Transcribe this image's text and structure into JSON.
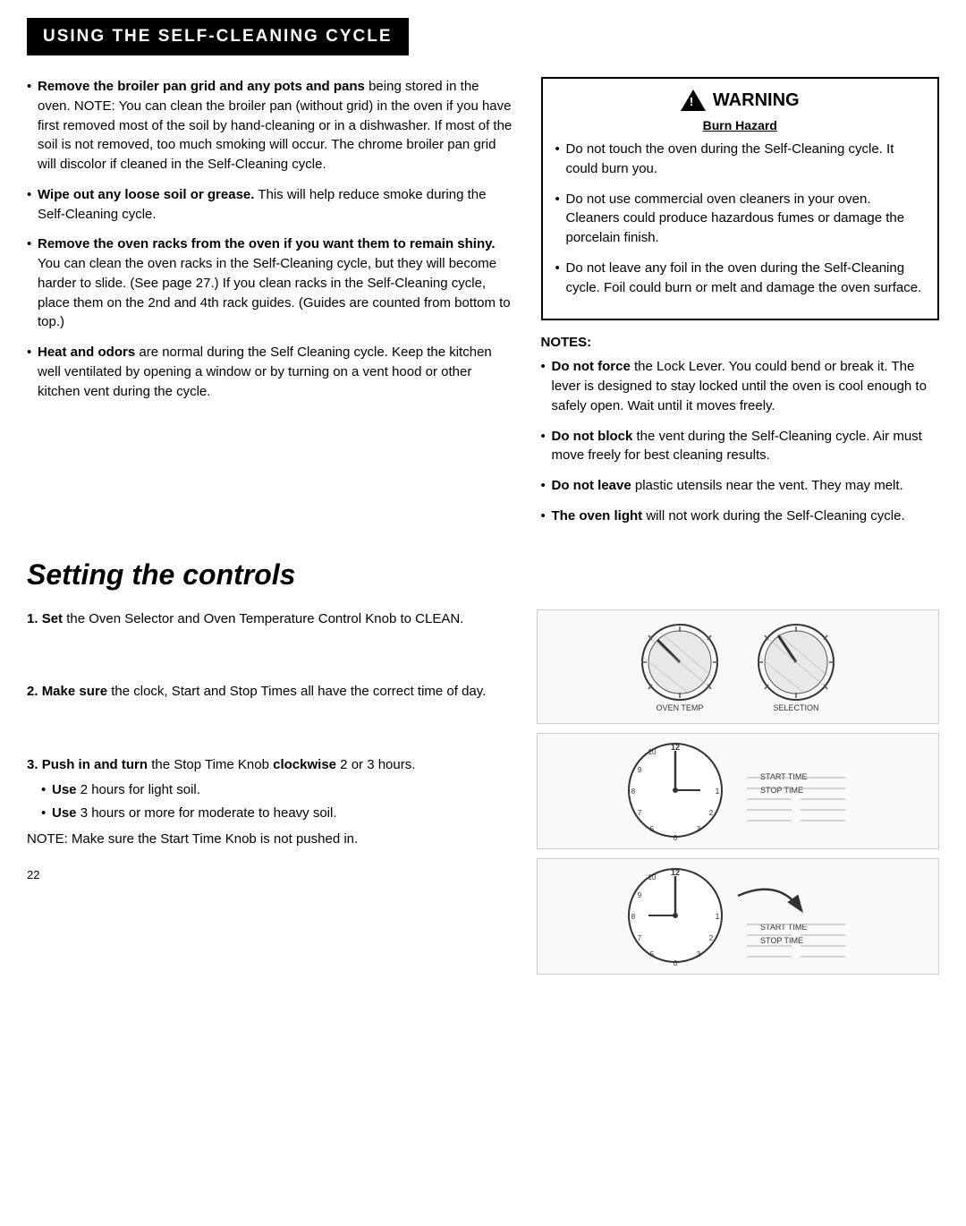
{
  "header": {
    "title": "USING THE SELF-CLEANING CYCLE"
  },
  "left_bullets": [
    {
      "bold_start": "Remove the broiler pan grid and any pots and pans",
      "text": " being stored in the oven. NOTE: You can clean the broiler pan (without grid) in the oven if you have first removed most of the soil by hand-cleaning or in a dishwasher. If most of the soil is not removed, too much smoking will occur. The chrome broiler pan grid will discolor if cleaned in the Self-Cleaning cycle."
    },
    {
      "bold_start": "Wipe out any loose soil or grease.",
      "text": " This will help reduce smoke during the Self-Cleaning cycle."
    },
    {
      "bold_start": "Remove the oven racks from the oven if you want them to remain shiny.",
      "text": " You can clean the oven racks in the Self-Cleaning cycle, but they will become harder to slide. (See page 27.) If you clean racks in the Self-Cleaning cycle, place them on the 2nd and 4th rack guides. (Guides are counted from bottom to top.)"
    },
    {
      "bold_start": "Heat and odors",
      "text": " are normal during the Self Cleaning cycle. Keep the kitchen well ventilated by opening a window or by turning on a vent hood or other kitchen vent during the cycle."
    }
  ],
  "warning": {
    "title": "WARNING",
    "subtitle": "Burn Hazard",
    "bullets": [
      "Do not touch the oven during the Self-Cleaning cycle. It could burn you.",
      "Do not use commercial oven cleaners in your oven. Cleaners could produce hazardous fumes or damage the porcelain finish.",
      "Do not leave any foil in the oven during the Self-Cleaning cycle. Foil could burn or melt and damage the oven surface."
    ]
  },
  "notes": {
    "title": "NOTES:",
    "bullets": [
      {
        "bold_start": "Do not force",
        "text": " the Lock Lever. You could bend or break it. The lever is designed to stay locked until the oven is cool enough to safely open. Wait until it moves freely."
      },
      {
        "bold_start": "Do not block",
        "text": " the vent during the Self-Cleaning cycle. Air must move freely for best cleaning results."
      },
      {
        "bold_start": "Do not leave",
        "text": " plastic utensils near the vent. They may melt."
      },
      {
        "bold_start": "The oven light",
        "text": " will not work during the Self-Cleaning cycle."
      }
    ]
  },
  "controls_section": {
    "title": "Setting the controls",
    "steps": [
      {
        "number": "1.",
        "text_bold": "Set",
        "text_rest": " the Oven Selector and Oven Temperature Control Knob to CLEAN.",
        "sub_bullets": [],
        "note": ""
      },
      {
        "number": "2.",
        "text_bold": "Make sure",
        "text_rest": " the clock, Start and Stop Times all have the correct time of day.",
        "sub_bullets": [],
        "note": ""
      },
      {
        "number": "3.",
        "text_bold": "Push in and turn",
        "text_rest": " the Stop Time Knob clockwise 2 or 3 hours.",
        "sub_bullets": [
          {
            "bold": "Use",
            "text": " 2 hours for light soil."
          },
          {
            "bold": "Use",
            "text": " 3 hours or more for moderate to heavy soil."
          }
        ],
        "note": "NOTE: Make sure the Start Time Knob is not pushed in."
      }
    ]
  },
  "page_number": "22"
}
